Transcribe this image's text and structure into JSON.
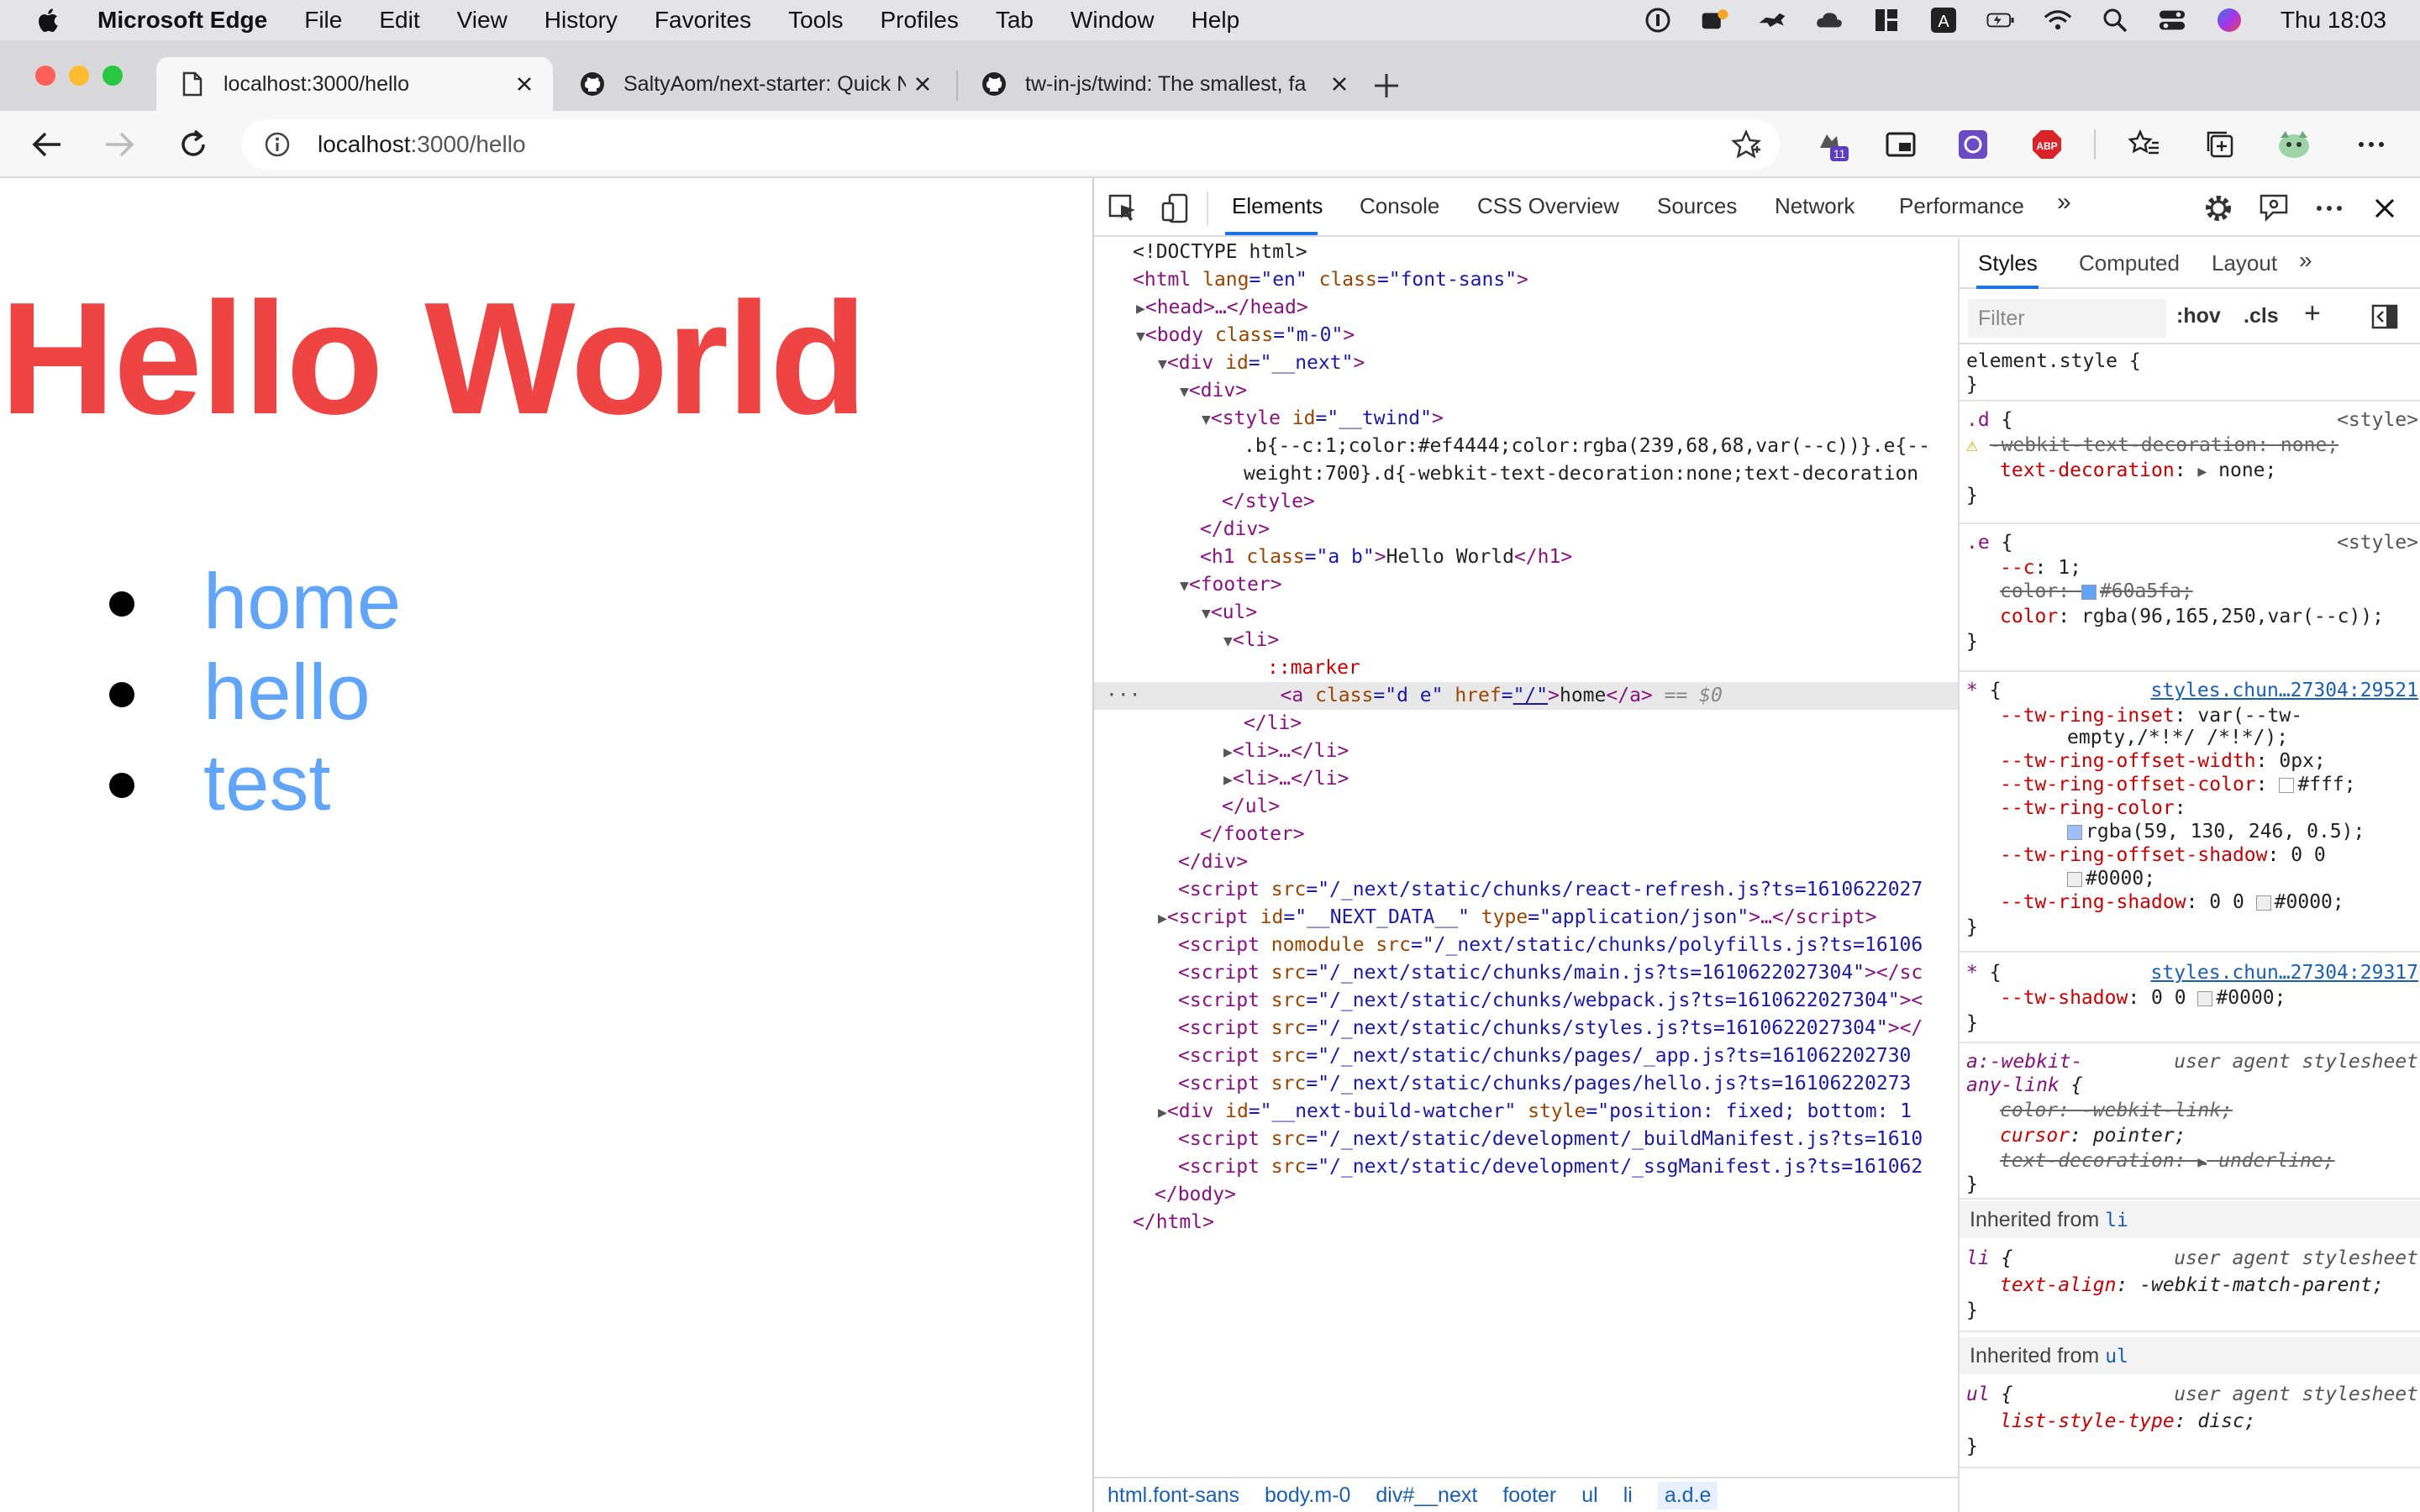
{
  "menubar": {
    "app_name": "Microsoft Edge",
    "items": [
      "File",
      "Edit",
      "View",
      "History",
      "Favorites",
      "Tools",
      "Profiles",
      "Tab",
      "Window",
      "Help"
    ],
    "clock": "Thu 18:03",
    "status_icons": [
      "onepassword-icon",
      "notification-icon",
      "cat-icon",
      "cloud-icon",
      "grid-icon",
      "input-source-icon",
      "battery-icon",
      "wifi-icon",
      "search-icon",
      "control-center-icon",
      "siri-icon"
    ]
  },
  "tabs": [
    {
      "title": "localhost:3000/hello",
      "icon": "page-icon",
      "active": true
    },
    {
      "title": "SaltyAom/next-starter: Quick N",
      "icon": "github-icon",
      "active": false
    },
    {
      "title": "tw-in-js/twind: The smallest, fa",
      "icon": "github-icon",
      "active": false
    }
  ],
  "address": {
    "host": "localhost",
    "path": ":3000/hello",
    "extension_badge": "11"
  },
  "page": {
    "title": "Hello World",
    "links": [
      "home",
      "hello",
      "test"
    ],
    "title_color": "#ef4444",
    "link_color": "#60a5fa"
  },
  "devtools": {
    "tabs": [
      "Elements",
      "Console",
      "CSS Overview",
      "Sources",
      "Network",
      "Performance"
    ],
    "more": "»",
    "dom": {
      "l1": "<!DOCTYPE html>",
      "html_open_tag": "<html",
      "html_lang_attr": "lang",
      "html_lang_val": "\"en\"",
      "html_class_attr": "class",
      "html_class_val": "\"font-sans\"",
      "head": "<head>…</head>",
      "body_class": "\"m-0\"",
      "div_id": "\"__next\"",
      "style_id": "\"__twind\"",
      "style_text_1": ".b{--c:1;color:#ef4444;color:rgba(239,68,68,var(--c))}.e{--",
      "style_text_2": "weight:700}.d{-webkit-text-decoration:none;text-decoration",
      "h1_class": "\"a b\"",
      "h1_text": "Hello World",
      "marker": "::marker",
      "a_class": "\"d e\"",
      "a_href": "\"/\"",
      "a_text": "home",
      "eq0": "== $0",
      "script_src_react": "\"/_next/static/chunks/react-refresh.js?ts=1610622027",
      "next_data_id": "\"__NEXT_DATA__\"",
      "next_data_type": "\"application/json\"",
      "script_src_polyfills": "\"/_next/static/chunks/polyfills.js?ts=16106",
      "script_src_main": "\"/_next/static/chunks/main.js?ts=1610622027304\"",
      "script_src_webpack": "\"/_next/static/chunks/webpack.js?ts=1610622027304\"",
      "script_src_styles": "\"/_next/static/chunks/styles.js?ts=1610622027304\"",
      "script_src_app": "\"/_next/static/chunks/pages/_app.js?ts=161062202730",
      "script_src_hello": "\"/_next/static/chunks/pages/hello.js?ts=16106220273",
      "watcher_id": "\"__next-build-watcher\"",
      "watcher_style": "\"position: fixed; bottom: 1",
      "script_src_build": "\"/_next/static/development/_buildManifest.js?ts=1610",
      "script_src_ssg": "\"/_next/static/development/_ssgManifest.js?ts=161062"
    },
    "breadcrumb": [
      "html.font-sans",
      "body.m-0",
      "div#__next",
      "footer",
      "ul",
      "li",
      "a.d.e"
    ],
    "styles": {
      "tabs": [
        "Styles",
        "Computed",
        "Layout"
      ],
      "filter_placeholder": "Filter",
      "hov": ":hov",
      "cls": ".cls",
      "element_style": "element.style {",
      "source_style": "<style>",
      "source_chunk_1": "styles.chun…27304:29521",
      "source_chunk_2": "styles.chun…27304:29317",
      "source_ua": "user agent stylesheet",
      "inherited_li": "Inherited from",
      "inherited_li_sel": "li",
      "inherited_ul_sel": "ul"
    }
  }
}
